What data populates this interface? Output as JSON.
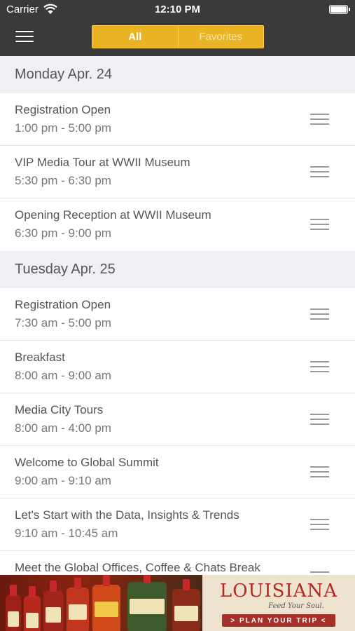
{
  "status_bar": {
    "carrier": "Carrier",
    "time": "12:10 PM"
  },
  "nav": {
    "tabs": [
      {
        "label": "All",
        "selected": true
      },
      {
        "label": "Favorites",
        "selected": false
      }
    ]
  },
  "schedule": [
    {
      "day": "Monday Apr. 24",
      "events": [
        {
          "title": "Registration Open",
          "time": "1:00 pm - 5:00 pm"
        },
        {
          "title": "VIP Media Tour at WWII Museum",
          "time": "5:30 pm - 6:30 pm"
        },
        {
          "title": "Opening Reception at WWII Museum",
          "time": "6:30 pm - 9:00 pm"
        }
      ]
    },
    {
      "day": "Tuesday Apr. 25",
      "events": [
        {
          "title": "Registration Open",
          "time": "7:30 am - 5:00 pm"
        },
        {
          "title": "Breakfast",
          "time": "8:00 am - 9:00 am"
        },
        {
          "title": "Media City Tours",
          "time": "8:00 am - 4:00 pm"
        },
        {
          "title": "Welcome to Global Summit",
          "time": "9:00 am - 9:10 am"
        },
        {
          "title": "Let's Start with the Data, Insights & Trends",
          "time": "9:10 am - 10:45 am"
        },
        {
          "title": "Meet the Global Offices, Coffee & Chats Break",
          "time": ""
        }
      ]
    }
  ],
  "ad": {
    "brand": "LOUISIANA",
    "tagline": "Feed Your Soul.",
    "cta": "> PLAN YOUR TRIP <"
  },
  "colors": {
    "nav_background": "#3a3a3a",
    "accent": "#e9b324",
    "section_background": "#efeff4"
  }
}
